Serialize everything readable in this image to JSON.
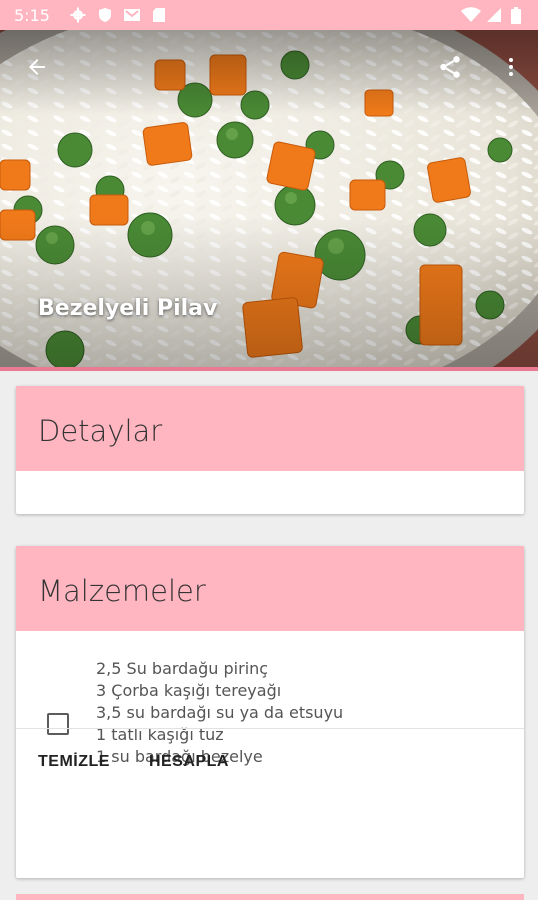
{
  "status_bar": {
    "time": "5:15",
    "left_icons": [
      "gear-icon",
      "shield-icon",
      "gmail-icon",
      "sd-card-icon"
    ],
    "right_icons": [
      "wifi-icon",
      "signal-icon",
      "battery-icon"
    ]
  },
  "toolbar": {
    "back_icon": "arrow-left-icon",
    "share_icon": "share-icon",
    "menu_icon": "more-vert-icon"
  },
  "hero": {
    "title": "Bezelyeli Pilav"
  },
  "details_card": {
    "title": "Detaylar"
  },
  "ingredients_card": {
    "title": "Malzemeler",
    "lines": [
      "2,5 Su bardağu pirinç",
      "3 Çorba kaşığı tereyağı",
      "3,5 su bardağı su ya da etsuyu",
      "1 tatlı kaşığı tuz",
      "1 su bardağı bezelye"
    ],
    "actions": {
      "clear": "TEMİZLE",
      "calculate": "HESAPLA"
    }
  },
  "colors": {
    "accent": "#ffb6c1",
    "divider": "#ea7a94"
  }
}
